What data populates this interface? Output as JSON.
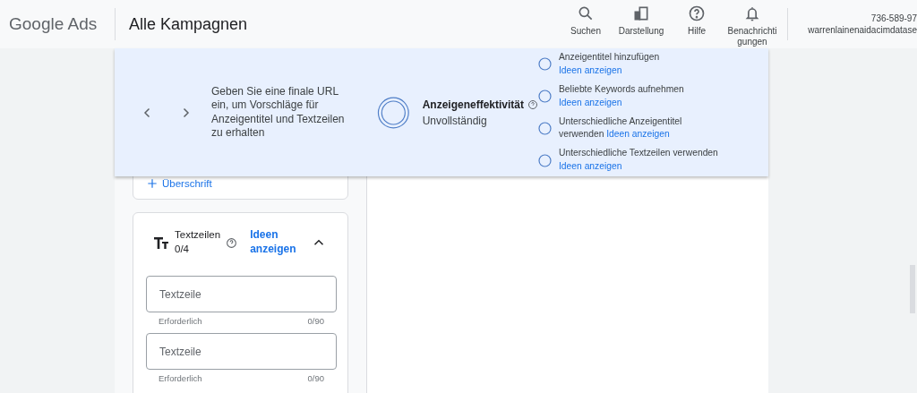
{
  "header": {
    "logo": "Google Ads",
    "page_title": "Alle Kampagnen",
    "actions": [
      {
        "label": "Suchen",
        "kind": "search"
      },
      {
        "label": "Darstellung",
        "kind": "chart"
      },
      {
        "label": "Hilfe",
        "kind": "help"
      },
      {
        "label": "Benachrichti gungen",
        "kind": "bell"
      }
    ],
    "account": {
      "id": "736-589-97",
      "email": "warrenlainenaidacimdatase"
    }
  },
  "banner": {
    "message": "Geben Sie eine finale URL ein, um Vorschläge für Anzeigentitel und Textzeilen zu erhalten",
    "effectiveness_label": "Anzeigeneffektivität",
    "effectiveness_status": "Unvollständig",
    "tips": [
      {
        "text": "Anzeigentitel hinzufügen",
        "link": "Ideen anzeigen",
        "checked": false
      },
      {
        "text": "Beliebte Keywords aufnehmen",
        "link": "Ideen anzeigen",
        "checked": false
      },
      {
        "text": "Unterschiedliche Anzeigentitel verwenden",
        "link": "Ideen anzeigen",
        "checked": false
      },
      {
        "text": "Unterschiedliche Textzeilen verwenden",
        "link": "Ideen anzeigen",
        "checked": false
      }
    ]
  },
  "headlines_card": {
    "add_link": "Überschrift"
  },
  "descriptions_card": {
    "title": "Textzeilen",
    "count": "0/4",
    "ideas_link": "Ideen anzeigen",
    "expanded": true,
    "fields": [
      {
        "placeholder": "Textzeile",
        "helper": "Erforderlich",
        "counter": "0/90"
      },
      {
        "placeholder": "Textzeile",
        "helper": "Erforderlich",
        "counter": "0/90"
      }
    ]
  }
}
